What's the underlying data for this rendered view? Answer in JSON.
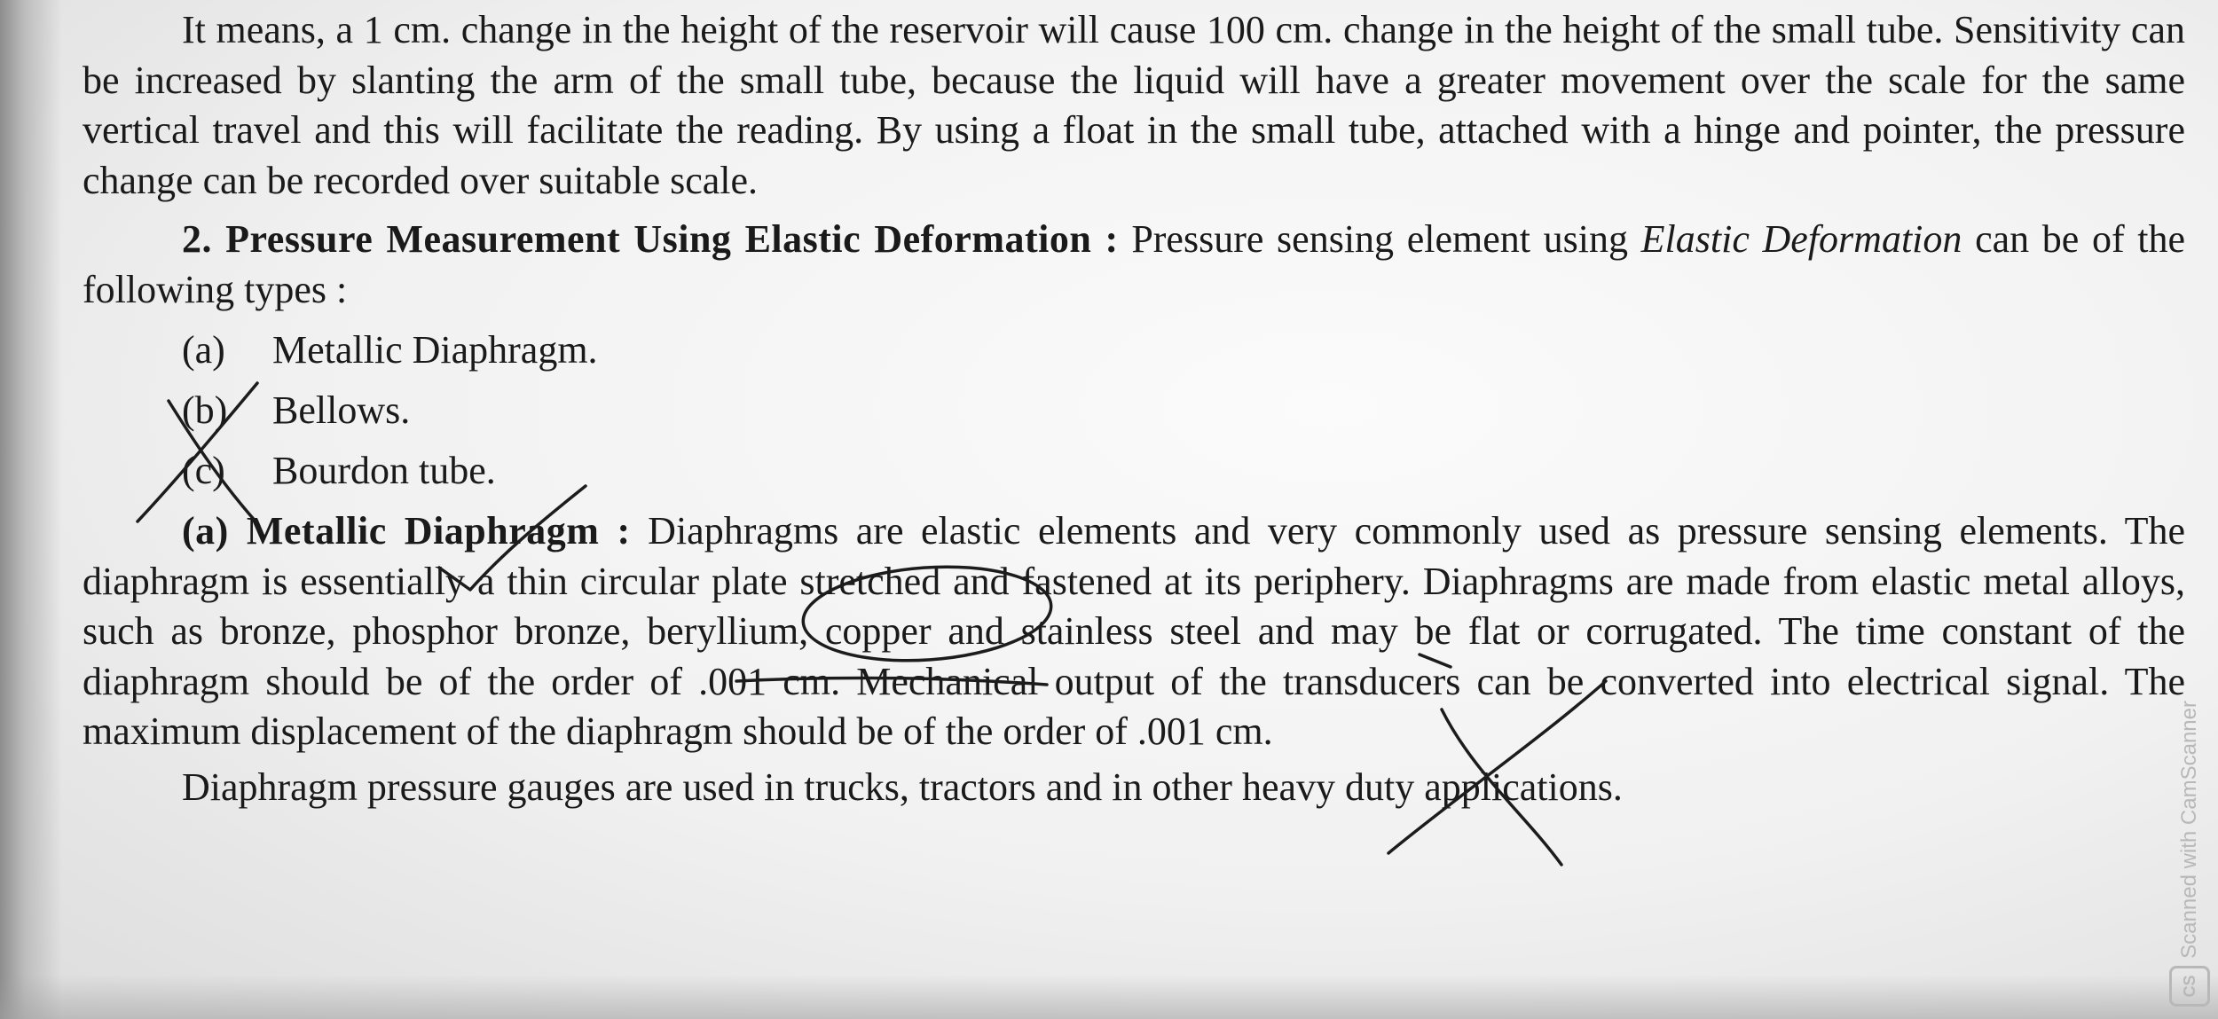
{
  "document": {
    "para1": "It means, a 1 cm. change in the height of the reservoir will cause 100 cm. change in the height of the small tube. Sensitivity can be increased by slanting the arm of the small tube, because the liquid will have a greater movement over the scale for the same vertical travel and this will facilitate the reading. By using a float in the small tube, attached with a hinge and pointer, the pressure change can be recorded over suitable scale.",
    "section2": {
      "number": "2.",
      "heading": "Pressure Measurement Using Elastic Deformation :",
      "text_before": "Pressure sensing element using",
      "emphasis": "Elastic Deformation",
      "text_after": "can be of the following types :"
    },
    "types": [
      {
        "marker": "(a)",
        "label": "Metallic Diaphragm."
      },
      {
        "marker": "(b)",
        "label": "Bellows."
      },
      {
        "marker": "(c)",
        "label": "Bourdon tube."
      }
    ],
    "subsection_a": {
      "label": "(a)",
      "heading": "Metallic Diaphragm :",
      "text": "Diaphragms are elastic elements and very commonly used as pressure sensing elements. The diaphragm is essentially a thin circular plate stretched and fastened at its periphery. Diaphragms are made from elastic metal alloys, such as bronze, phosphor bronze, beryllium, copper and stainless steel and may be flat or corrugated. The time constant of the diaphragm should be of the order of .001 cm. Mechanical output of the transducers can be converted into electrical signal. The maximum displacement of the diaphragm should be of the order of .001 cm."
    },
    "para_last": "Diaphragm pressure gauges are used in trucks, tractors and in other heavy duty applications.",
    "watermark": {
      "text": "Scanned with CamScanner",
      "logo": "CS"
    },
    "colors": {
      "ink": "#1a1a1a",
      "pen": "#1c1c1c",
      "paper": "#f3f3f3"
    }
  }
}
